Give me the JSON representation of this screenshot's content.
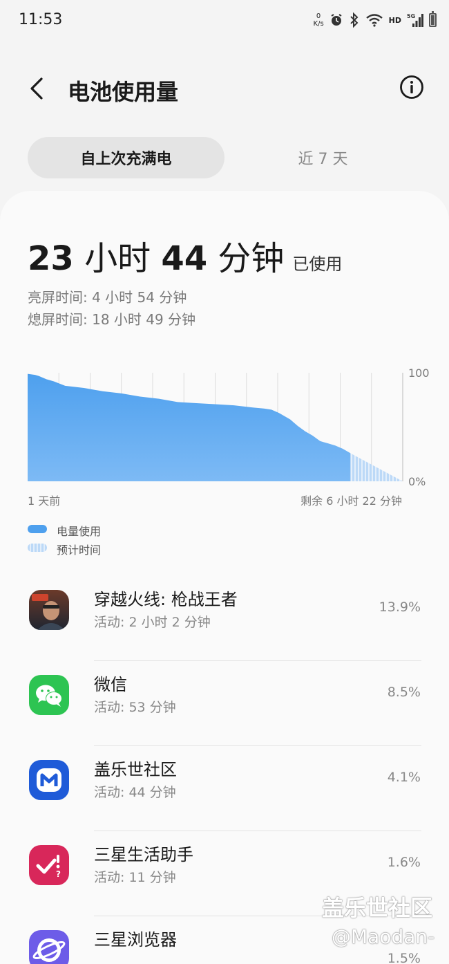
{
  "status_bar": {
    "time": "11:53",
    "net_speed_value": "0",
    "net_speed_unit": "K/s",
    "hd": "HD",
    "network": "5G"
  },
  "header": {
    "title": "电池使用量"
  },
  "tabs": [
    {
      "label": "自上次充满电",
      "selected": true
    },
    {
      "label": "近 7 天",
      "selected": false
    }
  ],
  "summary": {
    "hours": "23",
    "hours_unit": "小时",
    "minutes": "44",
    "minutes_unit": "分钟",
    "suffix": "已使用",
    "screen_on": "亮屏时间: 4 小时 54 分钟",
    "screen_off": "熄屏时间: 18 小时 49 分钟"
  },
  "chart_data": {
    "type": "area",
    "x_start_label": "1 天前",
    "x_end_label": "剩余 6 小时 22 分钟",
    "y_max_label": "100",
    "y_min_label": "0%",
    "ylim": [
      0,
      100
    ],
    "series": [
      {
        "name": "电量使用",
        "x": [
          0,
          0.02,
          0.03,
          0.05,
          0.07,
          0.1,
          0.15,
          0.2,
          0.25,
          0.3,
          0.35,
          0.4,
          0.45,
          0.5,
          0.55,
          0.6,
          0.63,
          0.65,
          0.67,
          0.7,
          0.72,
          0.74,
          0.76,
          0.78,
          0.79,
          0.8,
          0.82,
          0.84,
          0.85,
          0.86
        ],
        "values": [
          99,
          98,
          97,
          94,
          92,
          88,
          86,
          83,
          81,
          78,
          76,
          73,
          72,
          71,
          70,
          68,
          67,
          66,
          63,
          57,
          51,
          46,
          42,
          37,
          36,
          35,
          33,
          30,
          28,
          26
        ]
      },
      {
        "name": "预计时间",
        "x": [
          0.86,
          1.0
        ],
        "values": [
          26,
          0
        ]
      }
    ],
    "grid": true
  },
  "legend": [
    {
      "label": "电量使用",
      "style": "solid",
      "color": "#4ea0ee"
    },
    {
      "label": "预计时间",
      "style": "striped",
      "color": "#bcd9f7"
    }
  ],
  "apps": [
    {
      "name": "穿越火线: 枪战王者",
      "active": "活动: 2 小时 2 分钟",
      "percent": "13.9%",
      "icon": "game-icon"
    },
    {
      "name": "微信",
      "active": "活动: 53 分钟",
      "percent": "8.5%",
      "icon": "wechat-icon"
    },
    {
      "name": "盖乐世社区",
      "active": "活动: 44 分钟",
      "percent": "4.1%",
      "icon": "members-icon"
    },
    {
      "name": "三星生活助手",
      "active": "活动: 11 分钟",
      "percent": "1.6%",
      "icon": "life-assistant-icon"
    },
    {
      "name": "三星浏览器",
      "active": "",
      "percent": "1.5%",
      "icon": "browser-icon"
    }
  ],
  "watermark": {
    "brand": "盖乐世社区",
    "user": "@Maodan-"
  },
  "colors": {
    "chart_fill": "#4ea0ee",
    "chart_fill_light": "#7dbaf5",
    "projection": "#bcd9f7",
    "wechat": "#2dc452",
    "members": "#1f5bd8",
    "life_assistant": "#d8275a",
    "browser": "#6d5ce8"
  }
}
